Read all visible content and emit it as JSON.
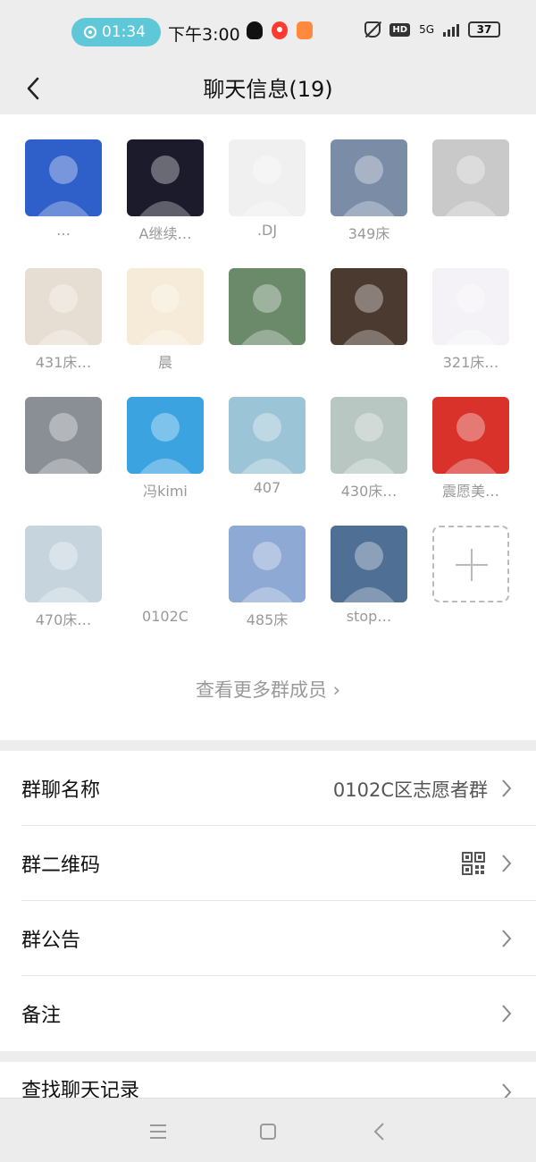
{
  "status_bar": {
    "record_time": "01:34",
    "clock": "下午3:00",
    "hd_label": "HD",
    "network_label": "5G",
    "battery": "37"
  },
  "header": {
    "title": "聊天信息(19)",
    "back_icon": "back-arrow-icon"
  },
  "members": [
    {
      "name": "…",
      "bg": "#2f5fc9"
    },
    {
      "name": "A继续…",
      "bg": "#1b1b2b"
    },
    {
      "name": ".DJ",
      "bg": "#f0f0f0"
    },
    {
      "name": "349床",
      "bg": "#7a8ca6"
    },
    {
      "name": "",
      "bg": "#c9c9c9"
    },
    {
      "name": "431床…",
      "bg": "#e7ded3"
    },
    {
      "name": "晨",
      "bg": "#f5ebd8"
    },
    {
      "name": "",
      "bg": "#6b8a6a"
    },
    {
      "name": "",
      "bg": "#4a3a30"
    },
    {
      "name": "321床…",
      "bg": "#f4f2f6"
    },
    {
      "name": "",
      "bg": "#8a8f96"
    },
    {
      "name": "冯kimi",
      "bg": "#3aa3e0"
    },
    {
      "name": "407",
      "bg": "#9bc4d6"
    },
    {
      "name": "430床…",
      "bg": "#b9c7c2"
    },
    {
      "name": "震愿美…",
      "bg": "#d8322a"
    },
    {
      "name": "470床…",
      "bg": "#c6d4de"
    },
    {
      "name": "0102C",
      "bg": "#ffffff"
    },
    {
      "name": "485床",
      "bg": "#8ea9d4"
    },
    {
      "name": "stop…",
      "bg": "#4f6f94"
    }
  ],
  "more_members": "查看更多群成员 ›",
  "settings": {
    "group_name_label": "群聊名称",
    "group_name_value": "0102C区志愿者群",
    "qr_label": "群二维码",
    "notice_label": "群公告",
    "remark_label": "备注",
    "search_label": "查找聊天记录"
  },
  "colors": {
    "accent_record": "#5fc8d8",
    "background": "#ededed"
  }
}
